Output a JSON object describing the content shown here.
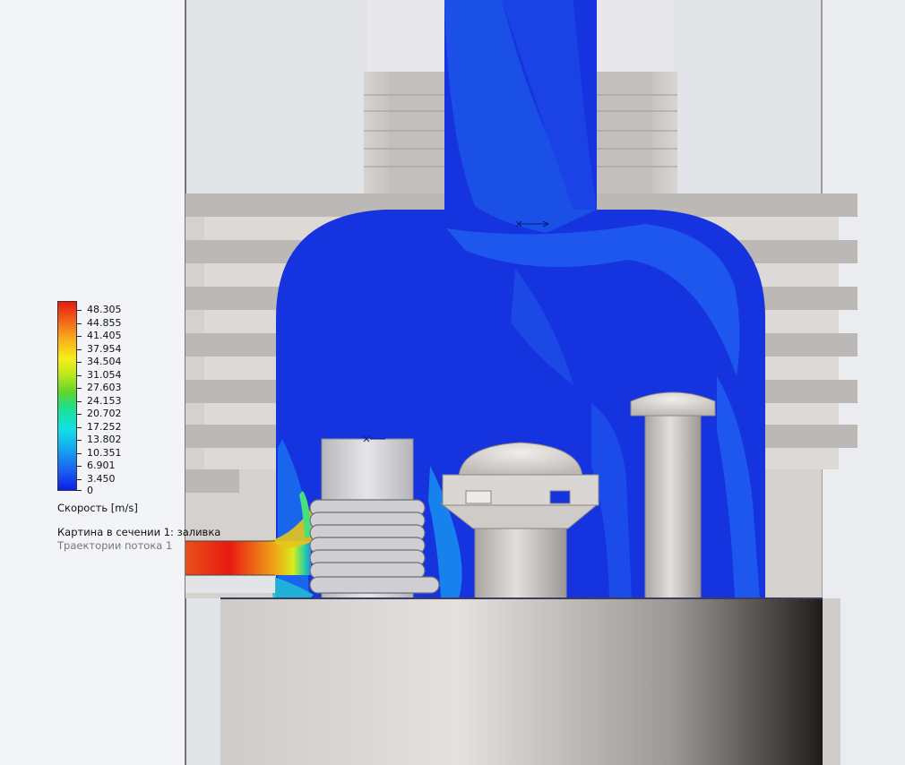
{
  "legend": {
    "colorbar_values": [
      "48.305",
      "44.855",
      "41.405",
      "37.954",
      "34.504",
      "31.054",
      "27.603",
      "24.153",
      "20.702",
      "17.252",
      "13.802",
      "10.351",
      "6.901",
      "3.450",
      "0"
    ],
    "quantity_label": "Скорость [m/s]",
    "plot_label": "Картина в сечении 1: заливка",
    "trajectory_label": "Траектории потока 1"
  },
  "colors": {
    "flow_low": "#1633e0",
    "flow_mid": "#14a8ef",
    "flow_high": "#e81a10",
    "metal": "#c9c5c2",
    "background": "#f2f4f7"
  }
}
